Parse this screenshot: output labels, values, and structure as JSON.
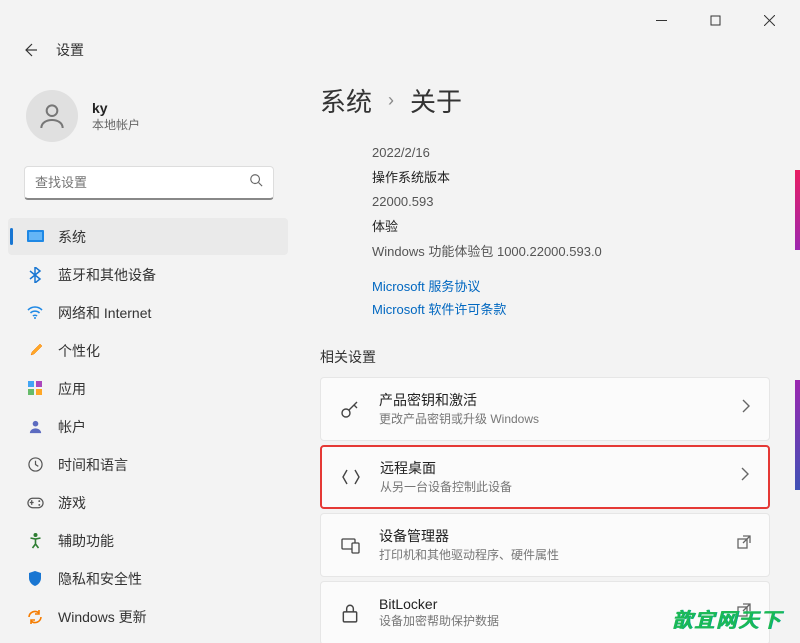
{
  "app_title": "设置",
  "user": {
    "name": "ky",
    "account_type": "本地帐户"
  },
  "search": {
    "placeholder": "查找设置"
  },
  "nav": [
    {
      "label": "系统",
      "icon": "display"
    },
    {
      "label": "蓝牙和其他设备",
      "icon": "bluetooth"
    },
    {
      "label": "网络和 Internet",
      "icon": "wifi"
    },
    {
      "label": "个性化",
      "icon": "brush"
    },
    {
      "label": "应用",
      "icon": "apps"
    },
    {
      "label": "帐户",
      "icon": "person"
    },
    {
      "label": "时间和语言",
      "icon": "clock"
    },
    {
      "label": "游戏",
      "icon": "game"
    },
    {
      "label": "辅助功能",
      "icon": "accessibility"
    },
    {
      "label": "隐私和安全性",
      "icon": "shield"
    },
    {
      "label": "Windows 更新",
      "icon": "update"
    }
  ],
  "breadcrumb": {
    "parent": "系统",
    "current": "关于"
  },
  "about": {
    "date": "2022/2/16",
    "os_version_label": "操作系统版本",
    "os_version": "22000.593",
    "experience_label": "体验",
    "experience": "Windows 功能体验包 1000.22000.593.0"
  },
  "links": {
    "service_agreement": "Microsoft 服务协议",
    "license_terms": "Microsoft 软件许可条款"
  },
  "related_section_title": "相关设置",
  "cards": [
    {
      "title": "产品密钥和激活",
      "sub": "更改产品密钥或升级 Windows",
      "icon": "key",
      "action": "chevron"
    },
    {
      "title": "远程桌面",
      "sub": "从另一台设备控制此设备",
      "icon": "remote",
      "action": "chevron"
    },
    {
      "title": "设备管理器",
      "sub": "打印机和其他驱动程序、硬件属性",
      "icon": "device",
      "action": "external"
    },
    {
      "title": "BitLocker",
      "sub": "设备加密帮助保护数据",
      "icon": "lock",
      "action": "external"
    }
  ],
  "watermark": "歆宜网天下"
}
